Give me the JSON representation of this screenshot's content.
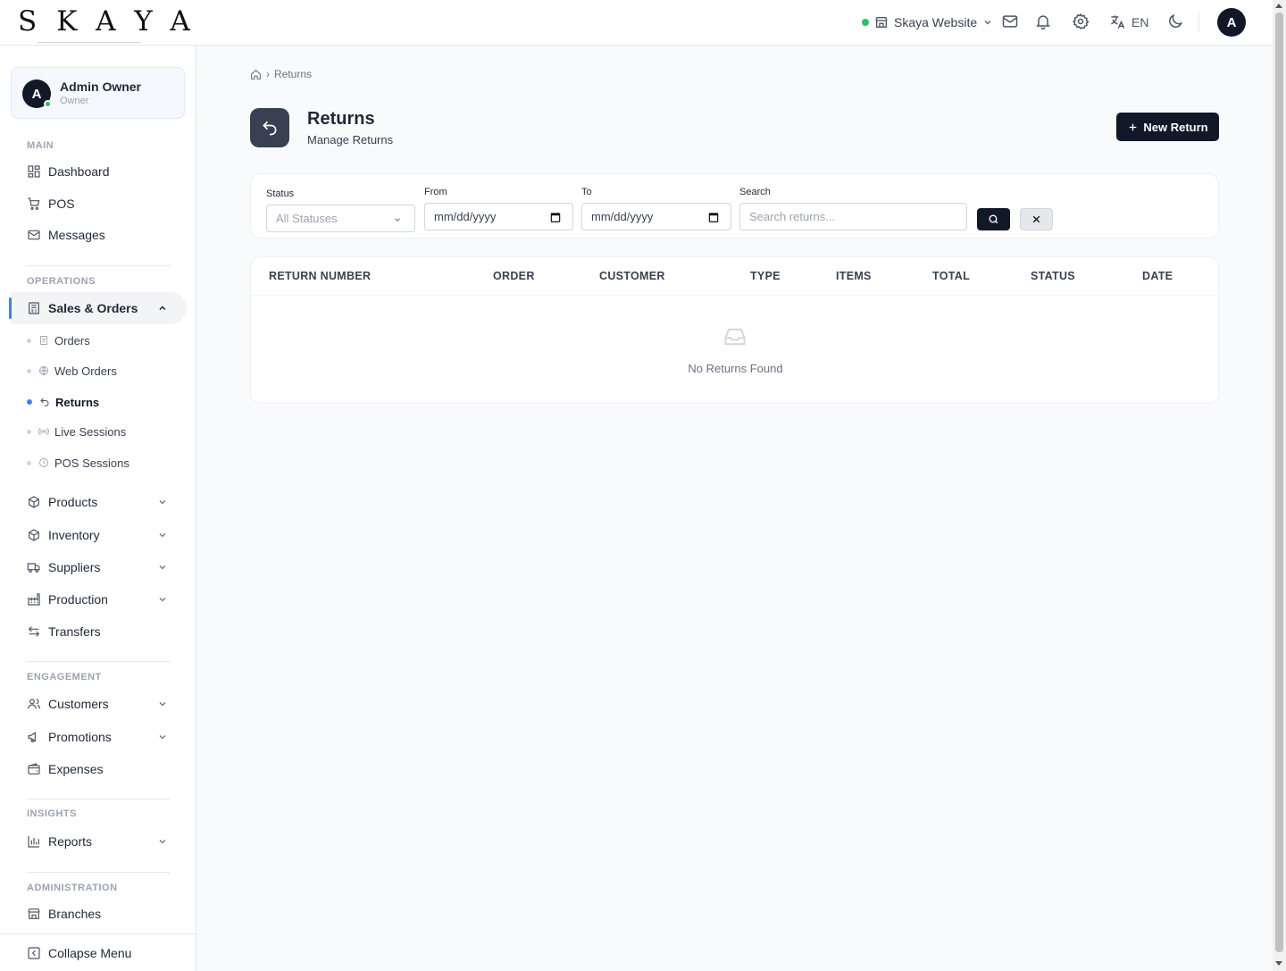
{
  "brand": {
    "logo": "SKAYA"
  },
  "topbar": {
    "store_name": "Skaya Website",
    "language": "EN",
    "avatar_letter": "A",
    "status_color": "#22c55e"
  },
  "user": {
    "initial": "A",
    "name": "Admin Owner",
    "role": "Owner"
  },
  "sidebar": {
    "sections": {
      "main": "MAIN",
      "operations": "OPERATIONS",
      "engagement": "ENGAGEMENT",
      "insights": "INSIGHTS",
      "administration": "ADMINISTRATION"
    },
    "main_items": [
      "Dashboard",
      "POS",
      "Messages"
    ],
    "sales_orders": "Sales & Orders",
    "sub_items": [
      "Orders",
      "Web Orders",
      "Returns",
      "Live Sessions",
      "POS Sessions"
    ],
    "ops_items": [
      "Products",
      "Inventory",
      "Suppliers",
      "Production",
      "Transfers"
    ],
    "engagement_items": [
      "Customers",
      "Promotions",
      "Expenses"
    ],
    "insights_items": [
      "Reports"
    ],
    "admin_items": [
      "Branches"
    ],
    "collapse": "Collapse Menu",
    "accent": "#3b82f6"
  },
  "breadcrumb": {
    "current": "Returns"
  },
  "page": {
    "title": "Returns",
    "subtitle": "Manage Returns",
    "new_button": "New Return"
  },
  "filters": {
    "status_label": "Status",
    "status_value": "All Statuses",
    "from_label": "From",
    "from_value": "mm/dd/yyyy",
    "to_label": "To",
    "to_value": "mm/dd/yyyy",
    "search_label": "Search",
    "search_placeholder": "Search returns..."
  },
  "table": {
    "columns": [
      "RETURN NUMBER",
      "ORDER",
      "CUSTOMER",
      "TYPE",
      "ITEMS",
      "TOTAL",
      "STATUS",
      "DATE"
    ],
    "empty_text": "No Returns Found"
  }
}
